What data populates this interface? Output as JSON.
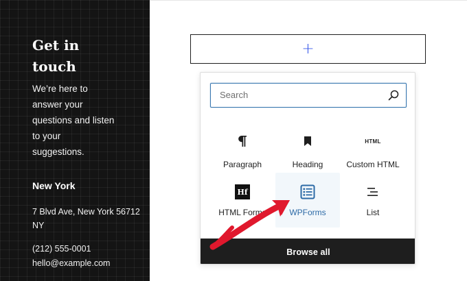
{
  "contact": {
    "title": "Get in touch",
    "intro": "We’re here to answer your questions and listen to your suggestions.",
    "city": "New York",
    "address": "7 Blvd Ave, New York 56712 NY",
    "phone": "(212) 555-0001",
    "email": "hello@example.com"
  },
  "appender": {
    "icon": "plus-icon",
    "glyph": "+"
  },
  "inserter": {
    "search_placeholder": "Search",
    "blocks": [
      {
        "label": "Paragraph",
        "icon": "paragraph-icon"
      },
      {
        "label": "Heading",
        "icon": "heading-bookmark-icon"
      },
      {
        "label": "Custom HTML",
        "icon": "html-icon",
        "icon_text": "HTML"
      },
      {
        "label": "HTML Forms",
        "icon": "html-forms-logo-icon",
        "icon_text": "Hf"
      },
      {
        "label": "WPForms",
        "icon": "wpforms-icon",
        "selected": true
      },
      {
        "label": "List",
        "icon": "list-icon"
      }
    ],
    "browse_all_label": "Browse all"
  },
  "colors": {
    "panel_bg": "#141414",
    "accent_blue": "#3858e9",
    "wpforms_blue": "#2c6aa6",
    "arrow_red": "#e0182d",
    "dark": "#1e1e1e"
  }
}
